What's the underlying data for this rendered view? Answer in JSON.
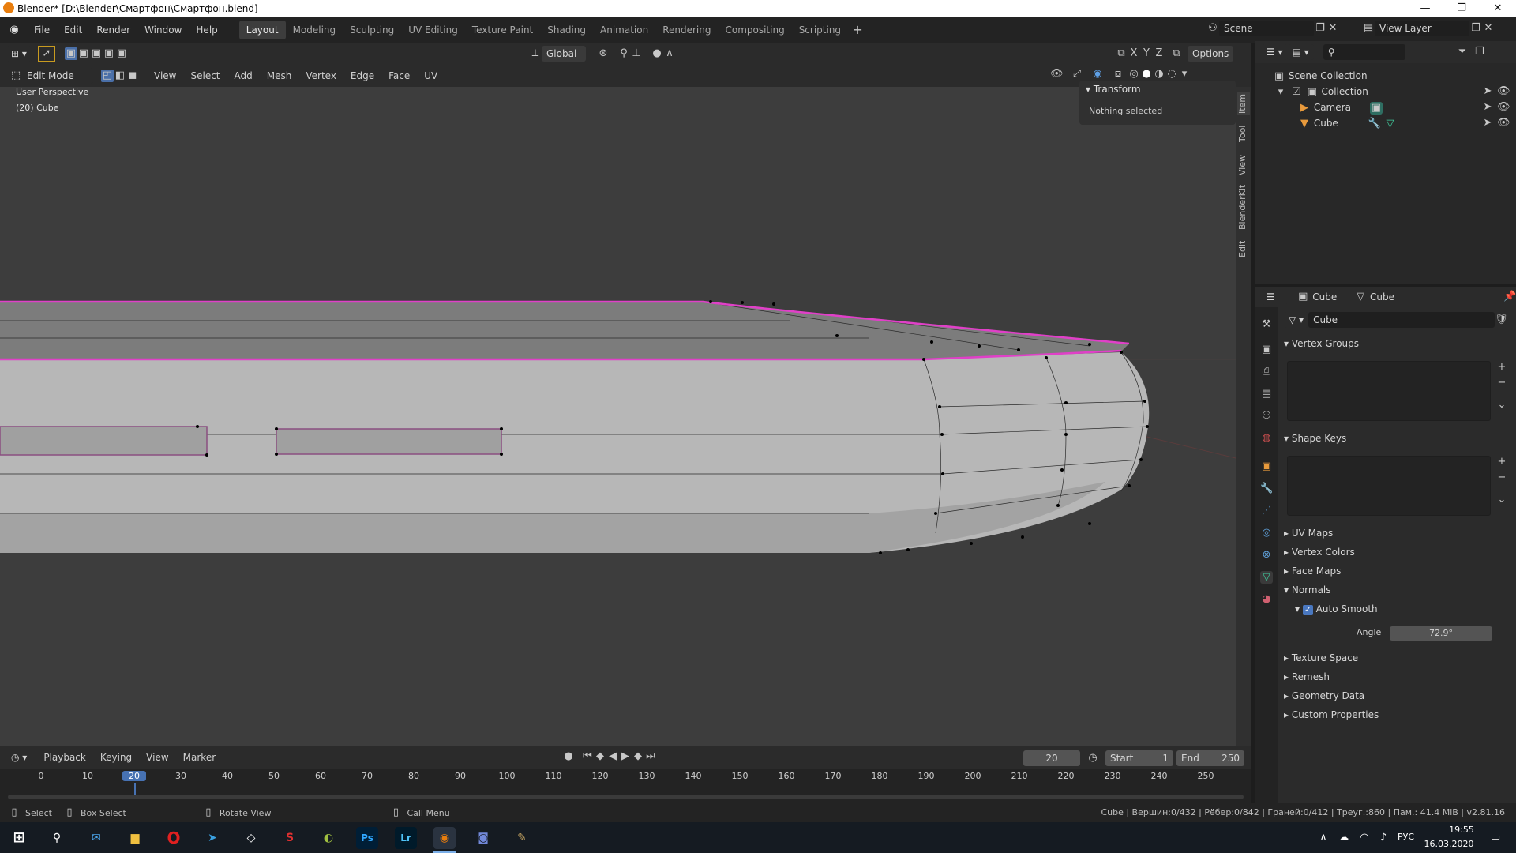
{
  "window": {
    "title": "Blender* [D:\\Blender\\Смартфон\\Смартфон.blend]",
    "controls": [
      "—",
      "❐",
      "✕"
    ]
  },
  "menu": [
    "File",
    "Edit",
    "Render",
    "Window",
    "Help"
  ],
  "workspaces": [
    {
      "label": "Layout",
      "active": true
    },
    {
      "label": "Modeling",
      "active": false
    },
    {
      "label": "Sculpting",
      "active": false
    },
    {
      "label": "UV Editing",
      "active": false
    },
    {
      "label": "Texture Paint",
      "active": false
    },
    {
      "label": "Shading",
      "active": false
    },
    {
      "label": "Animation",
      "active": false
    },
    {
      "label": "Rendering",
      "active": false
    },
    {
      "label": "Compositing",
      "active": false
    },
    {
      "label": "Scripting",
      "active": false
    }
  ],
  "scene": {
    "label": "Scene",
    "view_layer": "View Layer"
  },
  "header": {
    "transform_orientation": "Global",
    "axes": [
      "X",
      "Y",
      "Z"
    ],
    "options": "Options",
    "mode": "Edit Mode",
    "menus": [
      "View",
      "Select",
      "Add",
      "Mesh",
      "Vertex",
      "Edge",
      "Face",
      "UV"
    ]
  },
  "viewport": {
    "perspective": "User Perspective",
    "object_info": "(20) Cube",
    "colors": {
      "bg": "#3d3d3d",
      "mesh_top": "#7d7d7d",
      "mesh_side": "#b4b4b4",
      "edge_select": "#e040c8"
    }
  },
  "npanel": {
    "section": "Transform",
    "message": "Nothing selected",
    "tabs": [
      "Item",
      "Tool",
      "View",
      "BlenderKit",
      "Edit"
    ]
  },
  "outliner": {
    "root": "Scene Collection",
    "items": [
      {
        "label": "Collection",
        "level": 1
      },
      {
        "label": "Camera",
        "level": 2
      },
      {
        "label": "Cube",
        "level": 2
      }
    ]
  },
  "properties": {
    "breadcrumb_object": "Cube",
    "breadcrumb_data": "Cube",
    "data_name": "Cube",
    "sections": {
      "vertex_groups": "Vertex Groups",
      "shape_keys": "Shape Keys",
      "uv_maps": "UV Maps",
      "vertex_colors": "Vertex Colors",
      "face_maps": "Face Maps",
      "normals": "Normals",
      "auto_smooth": "Auto Smooth",
      "angle_label": "Angle",
      "angle_value": "72.9°",
      "texture_space": "Texture Space",
      "remesh": "Remesh",
      "geometry_data": "Geometry Data",
      "custom_properties": "Custom Properties"
    }
  },
  "timeline": {
    "menus": [
      "Playback",
      "Keying",
      "View",
      "Marker"
    ],
    "current_frame": "20",
    "start_label": "Start",
    "start": "1",
    "end_label": "End",
    "end": "250",
    "ticks": [
      "0",
      "10",
      "20",
      "30",
      "40",
      "50",
      "60",
      "70",
      "80",
      "90",
      "100",
      "110",
      "120",
      "130",
      "140",
      "150",
      "160",
      "170",
      "180",
      "190",
      "200",
      "210",
      "220",
      "230",
      "240",
      "250"
    ]
  },
  "status": {
    "select": "Select",
    "box_select": "Box Select",
    "rotate_view": "Rotate View",
    "call_menu": "Call Menu",
    "stats": "Cube | Вершин:0/432 | Рёбер:0/842 | Граней:0/412 | Треуг.:860 | Пам.: 41.4 MiB | v2.81.16"
  },
  "taskbar": {
    "lang": "РУС",
    "time": "19:55",
    "date": "16.03.2020",
    "apps": [
      "Ps",
      "Lr"
    ]
  }
}
